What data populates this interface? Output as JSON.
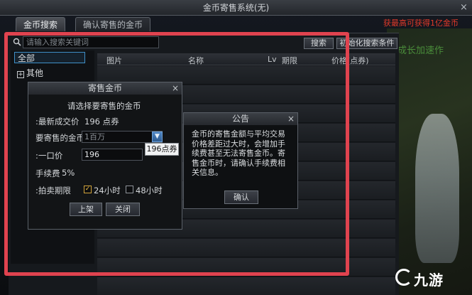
{
  "window": {
    "title": "金币寄售系统(无)",
    "close_glyph": "×"
  },
  "warning_text": "获最高可获得1亿金币",
  "tabs": [
    {
      "label": "金币搜索",
      "active": true
    },
    {
      "label": "确认寄售的金币",
      "active": false
    }
  ],
  "search": {
    "placeholder": "请输入搜索关键词",
    "button": "搜索",
    "advanced_button": "初始化搜索条件"
  },
  "categories": [
    {
      "label": "全部",
      "selected": true
    },
    {
      "label": "其他",
      "expand_glyph": "+"
    }
  ],
  "table": {
    "headers": [
      "图片",
      "名称",
      "Lv",
      "期限",
      "价格(点券)"
    ]
  },
  "sell_dialog": {
    "title": "寄售金币",
    "prompt": "请选择要寄售的金币",
    "last_price_label": ":最新成交价",
    "last_price_value": "196 点券",
    "gold_label": "要寄售的金币",
    "gold_value": "1百万",
    "price_label": ":一口价",
    "price_value": "196",
    "tooltip": "196点券",
    "fee_label": "手续费",
    "fee_value": "5%",
    "period_label": ":拍卖期限",
    "period_options": [
      {
        "label": "24小时",
        "checked": true
      },
      {
        "label": "48小时",
        "checked": false
      }
    ],
    "list_button": "上架",
    "close_button": "关闭"
  },
  "notice_dialog": {
    "title": "公告",
    "text": "金币的寄售金额与平均交易价格差距过大时，会增加手续费甚至无法寄售金币。寄售金币时，请确认手续费相关信息。",
    "confirm_button": "确认"
  },
  "right_side_text": "成长加速作",
  "watermark": {
    "text": "九游"
  },
  "colors": {
    "highlight": "#e0434f",
    "accent": "#3f90c8",
    "warning": "#e23a2a"
  }
}
